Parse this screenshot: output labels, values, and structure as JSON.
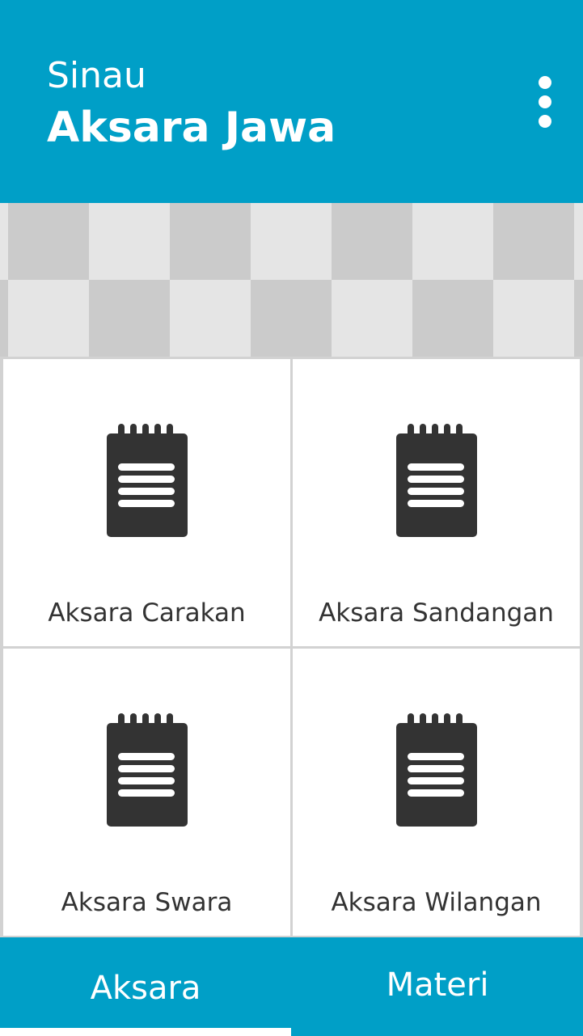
{
  "header": {
    "title_small": "Sinau",
    "title_large": "Aksara Jawa",
    "menu_icon": "more-vert-icon",
    "background": "#009FC7"
  },
  "banner": {
    "colors": [
      "#e5e5e5",
      "#cbcbcb"
    ]
  },
  "menu": {
    "icon": "notepad-icon",
    "items": [
      {
        "label": "Aksara Carakan"
      },
      {
        "label": "Aksara Sandangan"
      },
      {
        "label": "Aksara Swara"
      },
      {
        "label": "Aksara Wilangan"
      }
    ]
  },
  "tabs": [
    {
      "label": "Aksara",
      "selected": true
    },
    {
      "label": "Materi",
      "selected": false
    }
  ]
}
